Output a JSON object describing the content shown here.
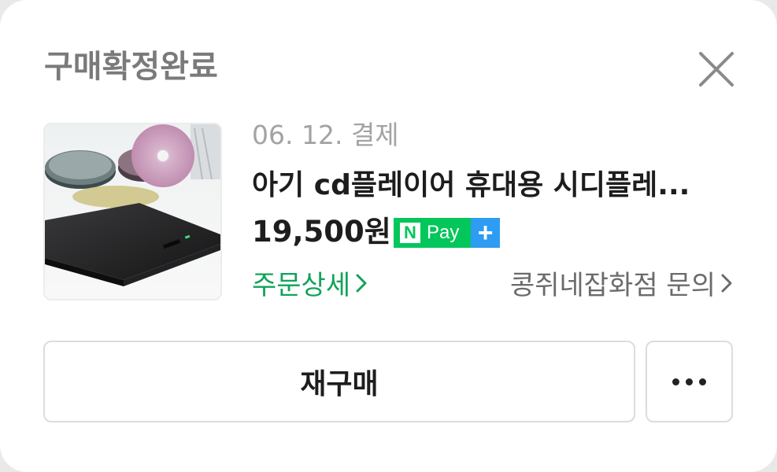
{
  "dialog": {
    "title": "구매확정완료"
  },
  "order": {
    "date": "06. 12. 결제",
    "product_name": "아기 cd플레이어 휴대용 시디플레...",
    "price": "19,500원",
    "payment_badge": {
      "n_letter": "N",
      "pay_text": "Pay",
      "plus": "+",
      "colors": {
        "green": "#03c75a",
        "blue": "#2d9cf2"
      }
    },
    "order_detail_link": "주문상세",
    "seller_inquiry_link": "콩쥐네잡화점 문의"
  },
  "actions": {
    "rebuy_label": "재구매"
  },
  "icons": {
    "close": "close-icon",
    "chevron": "chevron-right-icon",
    "more": "more-horizontal-icon"
  },
  "colors": {
    "accent_green": "#12a35a",
    "title_gray": "#7a7a7a",
    "text_dark": "#1d1d1d"
  }
}
